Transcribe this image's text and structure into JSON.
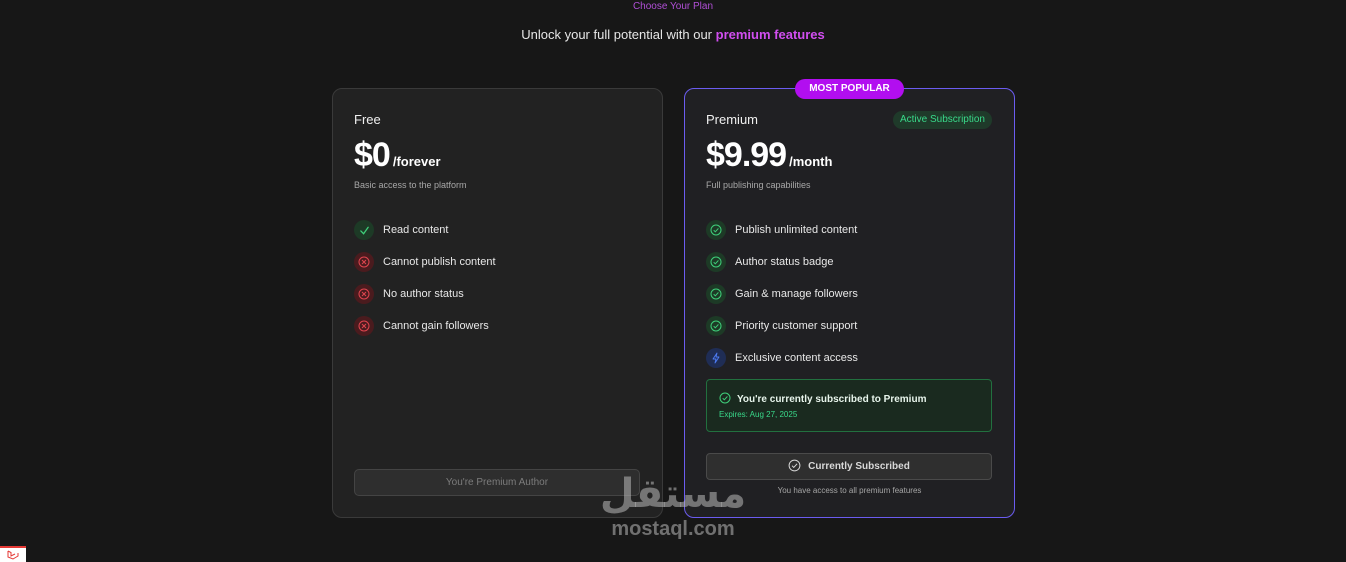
{
  "header": {
    "eyebrow": "Choose Your Plan",
    "subtitle_prefix": "Unlock your full potential with our",
    "subtitle_highlight": "premium features"
  },
  "free_plan": {
    "name": "Free",
    "price": "$0",
    "period": "/forever",
    "description": "Basic access to the platform",
    "features": [
      {
        "label": "Read content",
        "icon": "check-icon",
        "included": true
      },
      {
        "label": "Cannot publish content",
        "icon": "x-circle-icon",
        "included": false
      },
      {
        "label": "No author status",
        "icon": "x-circle-icon",
        "included": false
      },
      {
        "label": "Cannot gain followers",
        "icon": "x-circle-icon",
        "included": false
      }
    ],
    "button_label": "You're Premium Author"
  },
  "premium_plan": {
    "badge": "MOST POPULAR",
    "name": "Premium",
    "status_pill": "Active Subscription",
    "price": "$9.99",
    "period": "/month",
    "description": "Full publishing capabilities",
    "features": [
      {
        "label": "Publish unlimited content",
        "icon": "check-circle-icon",
        "included": true
      },
      {
        "label": "Author status badge",
        "icon": "check-circle-icon",
        "included": true
      },
      {
        "label": "Gain & manage followers",
        "icon": "check-circle-icon",
        "included": true
      },
      {
        "label": "Priority customer support",
        "icon": "check-circle-icon",
        "included": true
      },
      {
        "label": "Exclusive content access",
        "icon": "lightning-icon",
        "included": true
      }
    ],
    "subscription_notice": "You're currently subscribed to Premium",
    "expiry": "Expires: Aug 27, 2025",
    "button_label": "Currently Subscribed",
    "access_note": "You have access to all premium features"
  },
  "watermark": {
    "arabic": "مستقل",
    "latin": "mostaql.com"
  },
  "colors": {
    "background": "#171717",
    "accent_purple": "#b20ef0",
    "success_green": "#39d98a",
    "error_red": "#e0454f",
    "premium_border": "#6b5cf0"
  }
}
